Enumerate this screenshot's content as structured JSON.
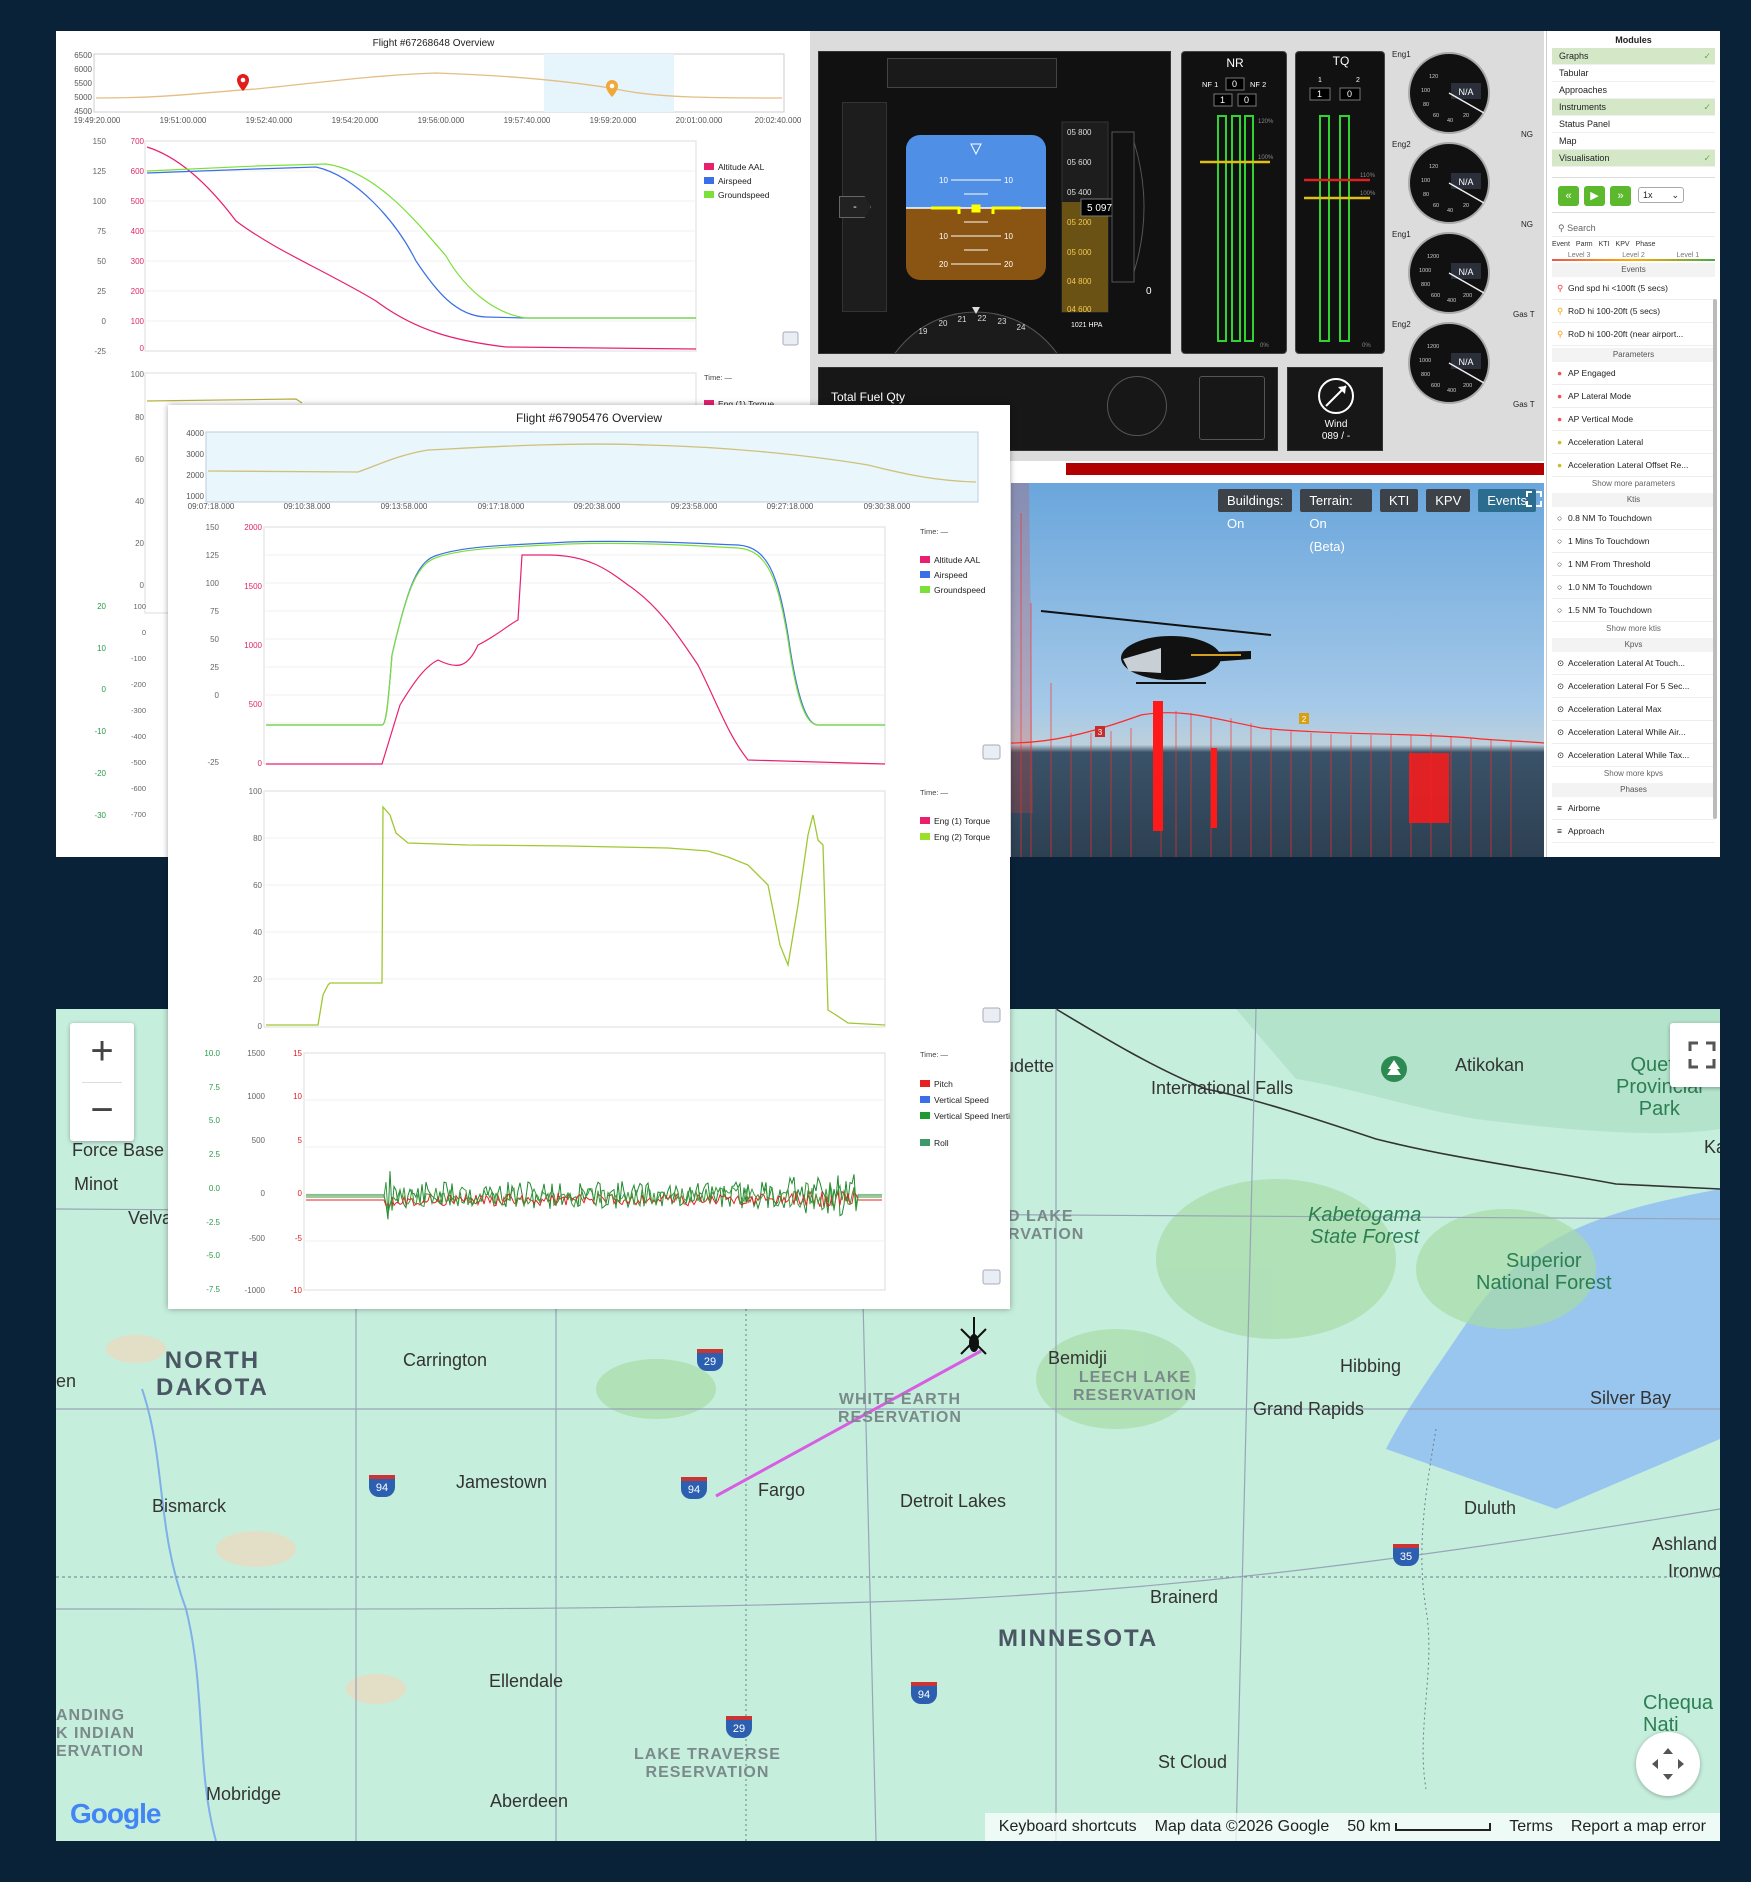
{
  "chart1": {
    "title": "Flight #67268648 Overview",
    "overview_yticks": [
      "6500",
      "6000",
      "5500",
      "5000",
      "4500"
    ],
    "overview_xticks": [
      "19:49:20.000",
      "19:51:00.000",
      "19:52:40.000",
      "19:54:20.000",
      "19:56:00.000",
      "19:57:40.000",
      "19:59:20.000",
      "20:01:00.000",
      "20:02:40.000"
    ],
    "panel1": {
      "left_ticks": [
        "150",
        "125",
        "100",
        "75",
        "50",
        "25",
        "0",
        "-25"
      ],
      "red_ticks": [
        "700",
        "600",
        "500",
        "400",
        "300",
        "200",
        "100",
        "0"
      ],
      "legend": [
        "Altitude AAL",
        "Airspeed",
        "Groundspeed"
      ],
      "legend_colors": [
        "#e8216f",
        "#3b6fe8",
        "#7ce03a"
      ]
    },
    "panel2": {
      "time_label": "Time: —",
      "left_ticks": [
        "100",
        "80",
        "60",
        "40",
        "20",
        "0"
      ],
      "legend": [
        "Eng (1) Torque"
      ]
    },
    "panel3": {
      "left_ticks_green": [
        "20",
        "10",
        "0",
        "-10",
        "-20",
        "-30"
      ],
      "left_ticks": [
        "100",
        "0",
        "-100",
        "-200",
        "-300",
        "-400",
        "-500",
        "-600",
        "-700"
      ]
    },
    "time_label": "Time: —"
  },
  "chart2": {
    "title": "Flight #67905476 Overview",
    "overview_yticks": [
      "4000",
      "3000",
      "2000",
      "1000"
    ],
    "overview_xticks": [
      "09:07:18.000",
      "09:10:38.000",
      "09:13:58.000",
      "09:17:18.000",
      "09:20:38.000",
      "09:23:58.000",
      "09:27:18.000",
      "09:30:38.000"
    ],
    "time_label": "Time: —",
    "panel1": {
      "left_ticks": [
        "150",
        "125",
        "100",
        "75",
        "50",
        "25",
        "0",
        "-25"
      ],
      "red_ticks": [
        "2000",
        "1500",
        "1000",
        "500",
        "0"
      ],
      "legend": [
        "Altitude AAL",
        "Airspeed",
        "Groundspeed"
      ],
      "legend_colors": [
        "#e8216f",
        "#3b6fe8",
        "#7ce03a"
      ]
    },
    "panel2": {
      "left_ticks": [
        "100",
        "80",
        "60",
        "40",
        "20",
        "0"
      ],
      "legend": [
        "Eng (1) Torque",
        "Eng (2) Torque"
      ],
      "legend_colors": [
        "#e8216f",
        "#9be02a"
      ]
    },
    "panel3": {
      "green_ticks": [
        "10.0",
        "7.5",
        "5.0",
        "2.5",
        "0.0",
        "-2.5",
        "-5.0",
        "-7.5"
      ],
      "left_ticks": [
        "1500",
        "1000",
        "500",
        "0",
        "-500",
        "-1000"
      ],
      "red_ticks": [
        "15",
        "10",
        "5",
        "0",
        "-5",
        "-10"
      ],
      "legend": [
        "Pitch",
        "Vertical Speed",
        "Vertical Speed Inertial",
        "Roll"
      ],
      "legend_colors": [
        "#e82020",
        "#3b6fe8",
        "#1f9a2f",
        "#3d9a6a"
      ]
    }
  },
  "instruments": {
    "nr_label": "NR",
    "tq_label": "TQ",
    "nf1": "NF 1",
    "nf2": "NF 2",
    "nr_top": "0",
    "nr_vals": [
      "1",
      "0"
    ],
    "tq_top": [
      "1",
      "2"
    ],
    "tq_vals": [
      "1",
      "0"
    ],
    "pct_120": "120%",
    "pct_100": "100%",
    "pct_110": "110%",
    "pct_0": "0%",
    "alt_ticks": [
      "05 800",
      "05 600",
      "05 400",
      "05 200",
      "05 000",
      "04 800",
      "04 600"
    ],
    "alt_readout": "5 097",
    "vs_readout": "0",
    "baro": "1021 HPA",
    "heading_ticks": [
      "19",
      "20",
      "21",
      "22",
      "23",
      "24"
    ],
    "pitch_ticks": [
      "10",
      "10",
      "10",
      "10",
      "20",
      "20"
    ],
    "speed_bug": "-",
    "fuel_label": "Total Fuel Qty",
    "wind_label": "Wind",
    "wind_value": "089 / -",
    "gauges": [
      {
        "top": "Eng1",
        "side": "NG",
        "value": "N/A",
        "t1": "120",
        "t2": "100",
        "t3": "80",
        "t4": "60",
        "t5": "40",
        "t6": "20"
      },
      {
        "top": "Eng2",
        "side": "NG",
        "value": "N/A",
        "t1": "120",
        "t2": "100",
        "t3": "80",
        "t4": "60",
        "t5": "40",
        "t6": "20"
      },
      {
        "top": "Eng1",
        "side": "Gas T",
        "value": "N/A",
        "t1": "1200",
        "t2": "1000",
        "t3": "800",
        "t4": "600",
        "t5": "400",
        "t6": "200"
      },
      {
        "top": "Eng2",
        "side": "Gas T",
        "value": "N/A",
        "t1": "1200",
        "t2": "1000",
        "t3": "800",
        "t4": "600",
        "t5": "400",
        "t6": "200"
      }
    ]
  },
  "vis": {
    "buttons": [
      "Buildings: On",
      "Terrain: On (Beta)",
      "KTI",
      "KPV",
      "Events"
    ],
    "marker1": "3",
    "marker2": "2"
  },
  "modules": {
    "title": "Modules",
    "items": [
      {
        "label": "Graphs",
        "active": true
      },
      {
        "label": "Tabular",
        "active": false
      },
      {
        "label": "Approaches",
        "active": false
      },
      {
        "label": "Instruments",
        "active": true
      },
      {
        "label": "Status Panel",
        "active": false
      },
      {
        "label": "Map",
        "active": false
      },
      {
        "label": "Visualisation",
        "active": true
      }
    ],
    "check": "✓",
    "speed": "1x",
    "search_placeholder": "Search",
    "filters": [
      "Event",
      "Parm",
      "KTI",
      "KPV",
      "Phase"
    ],
    "levels": [
      "Level 3",
      "Level 2",
      "Level 1"
    ],
    "events_title": "Events",
    "events": [
      "Gnd spd hi <100ft (5 secs)",
      "RoD hi 100-20ft (5 secs)",
      "RoD hi 100-20ft (near airport..."
    ],
    "params_title": "Parameters",
    "params": [
      "AP Engaged",
      "AP Lateral Mode",
      "AP Vertical Mode",
      "Acceleration Lateral",
      "Acceleration Lateral Offset Re..."
    ],
    "params_more": "Show more parameters",
    "ktis_title": "Ktis",
    "ktis": [
      "0.8 NM To Touchdown",
      "1 Mins To Touchdown",
      "1 NM From Threshold",
      "1.0 NM To Touchdown",
      "1.5 NM To Touchdown"
    ],
    "ktis_more": "Show more ktis",
    "kpvs_title": "Kpvs",
    "kpvs": [
      "Acceleration Lateral At Touch...",
      "Acceleration Lateral For 5 Sec...",
      "Acceleration Lateral Max",
      "Acceleration Lateral While Air...",
      "Acceleration Lateral While Tax..."
    ],
    "kpvs_more": "Show more kpvs",
    "phases_title": "Phases",
    "phases": [
      "Airborne",
      "Approach"
    ]
  },
  "map": {
    "zoom_in": "+",
    "zoom_out": "−",
    "cities": [
      {
        "name": "Baudette"
      },
      {
        "name": "International Falls"
      },
      {
        "name": "Atikokan"
      },
      {
        "name": "Minot"
      },
      {
        "name": "Velva"
      },
      {
        "name": "Carrington"
      },
      {
        "name": "Bemidji"
      },
      {
        "name": "Hibbing"
      },
      {
        "name": "Grand Rapids"
      },
      {
        "name": "Silver Bay"
      },
      {
        "name": "Jamestown"
      },
      {
        "name": "Fargo"
      },
      {
        "name": "Detroit Lakes"
      },
      {
        "name": "Bismarck"
      },
      {
        "name": "Duluth"
      },
      {
        "name": "Ashland"
      },
      {
        "name": "Ironwood"
      },
      {
        "name": "Brainerd"
      },
      {
        "name": "Ellendale"
      },
      {
        "name": "St Cloud"
      },
      {
        "name": "Mobridge"
      },
      {
        "name": "Aberdeen"
      }
    ],
    "regions": {
      "nd": [
        "NORTH",
        "DAKOTA"
      ],
      "mn": "MINNESOTA",
      "white_earth": [
        "WHITE EARTH",
        "RESERVATION"
      ],
      "leech_lake": [
        "LEECH LAKE",
        "RESERVATION"
      ],
      "lake_traverse": [
        "LAKE TRAVERSE",
        "RESERVATION"
      ],
      "red_lake": [
        "D LAKE",
        "RVATION"
      ],
      "standing_rock": [
        "ANDING",
        "K INDIAN",
        "ERVATION"
      ],
      "kabetogama": [
        "Kabetogama",
        "State Forest"
      ],
      "superior": [
        "Superior",
        "National Forest"
      ],
      "quetico": [
        "Quetic",
        "Provincial",
        "Park"
      ],
      "chequa": [
        "Chequa",
        "Nati"
      ],
      "air_base": [
        "ir",
        "Force Base"
      ],
      "ka": "Ka",
      "en": "en"
    },
    "highways": [
      "29",
      "94",
      "94",
      "29",
      "94",
      "35"
    ],
    "footer": {
      "shortcuts": "Keyboard shortcuts",
      "map_data": "Map data ©2026 Google",
      "scale": "50 km",
      "terms": "Terms",
      "report": "Report a map error"
    },
    "logo": "Google"
  }
}
